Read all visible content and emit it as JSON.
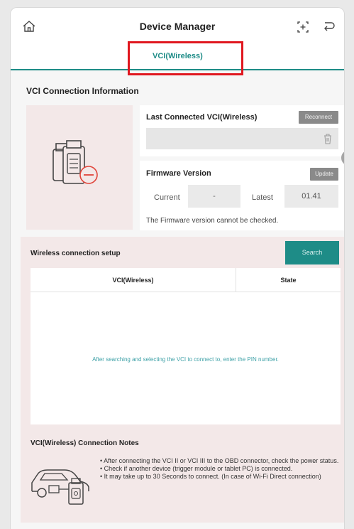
{
  "header": {
    "title": "Device Manager",
    "home_icon": "home-icon",
    "add_icon": "add-device-icon",
    "back_icon": "back-icon"
  },
  "tabs": [
    {
      "label": "VCI(Wireless)",
      "active": true
    }
  ],
  "connection_info": {
    "title": "VCI Connection Information",
    "last_connected": {
      "label": "Last Connected VCI(Wireless)",
      "reconnect_label": "Reconnect",
      "value": ""
    },
    "firmware": {
      "label": "Firmware Version",
      "update_label": "Update",
      "current_label": "Current",
      "current_value": "-",
      "latest_label": "Latest",
      "latest_value": "01.41",
      "note": "The Firmware version cannot be checked."
    }
  },
  "wireless_setup": {
    "title": "Wireless connection setup",
    "search_label": "Search",
    "columns": [
      "VCI(Wireless)",
      "State"
    ],
    "empty_message": "After searching and selecting the VCI to connect to, enter the PIN number."
  },
  "notes": {
    "title": "VCI(Wireless) Connection Notes",
    "items": [
      "• After connecting the VCI II or VCI III to the OBD connector, check the power status.",
      "• Check if another device (trigger module or tablet PC) is connected.",
      "• It may take up to 30 Seconds to connect. (In case of Wi-Fi Direct connection)"
    ]
  },
  "colors": {
    "accent": "#1e8c87",
    "highlight": "#e0171f",
    "panel": "#f3e8e8",
    "button_gray": "#8a8a8a"
  }
}
